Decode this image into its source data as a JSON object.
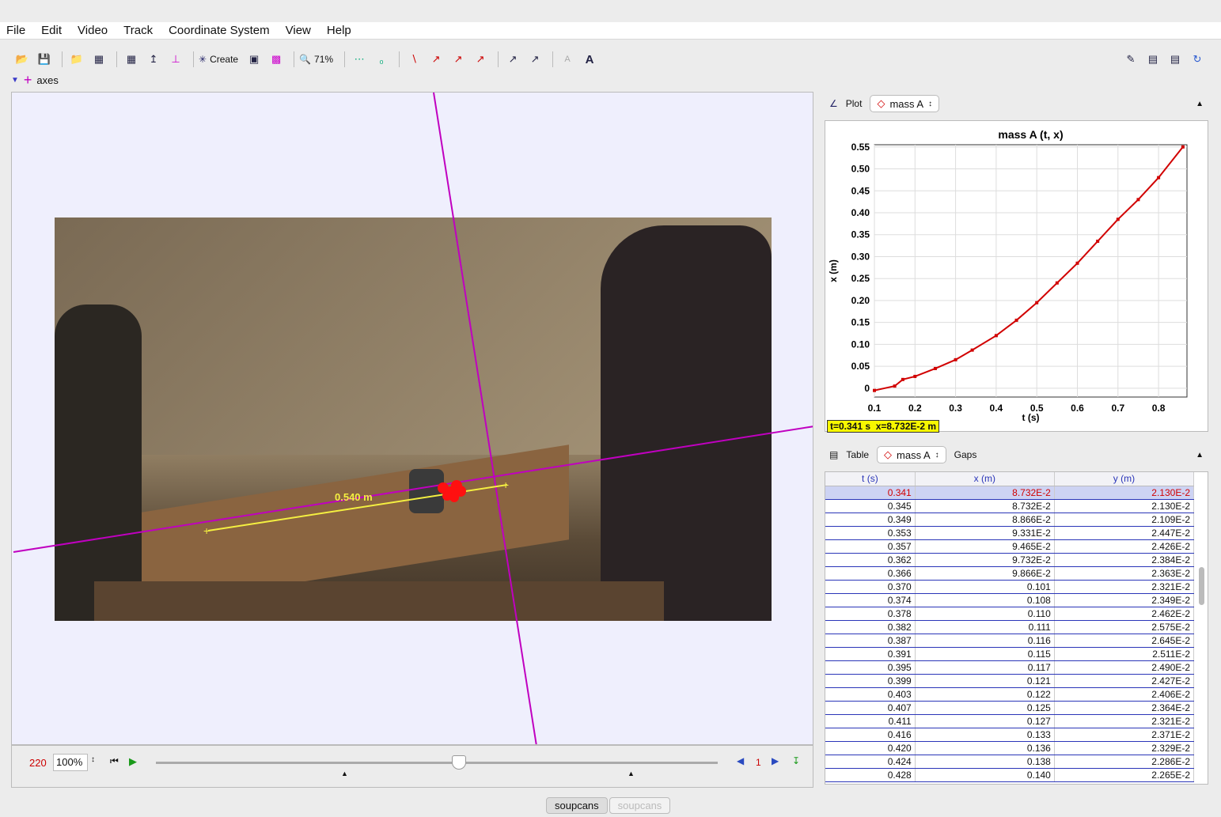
{
  "menu": [
    "File",
    "Edit",
    "Video",
    "Track",
    "Coordinate System",
    "View",
    "Help"
  ],
  "toolbar": {
    "create_label": "Create",
    "zoom_label": "71%"
  },
  "track_selector": {
    "label": "axes"
  },
  "video": {
    "measure_label": "0.540 m"
  },
  "player": {
    "frame": "220",
    "rate": "100%",
    "step": "1"
  },
  "plot_panel": {
    "tab_label": "Plot",
    "track": "mass A",
    "title": "mass A (t, x)",
    "xlabel": "t (s)",
    "ylabel": "x (m)",
    "readout": "t=0.341 s  x=8.732E-2 m"
  },
  "table_panel": {
    "tab_label": "Table",
    "track": "mass A",
    "gaps_label": "Gaps",
    "headers": [
      "t (s)",
      "x (m)",
      "y (m)"
    ],
    "rows": [
      [
        "0.341",
        "8.732E-2",
        "2.130E-2"
      ],
      [
        "0.345",
        "8.732E-2",
        "2.130E-2"
      ],
      [
        "0.349",
        "8.866E-2",
        "2.109E-2"
      ],
      [
        "0.353",
        "9.331E-2",
        "2.447E-2"
      ],
      [
        "0.357",
        "9.465E-2",
        "2.426E-2"
      ],
      [
        "0.362",
        "9.732E-2",
        "2.384E-2"
      ],
      [
        "0.366",
        "9.866E-2",
        "2.363E-2"
      ],
      [
        "0.370",
        "0.101",
        "2.321E-2"
      ],
      [
        "0.374",
        "0.108",
        "2.349E-2"
      ],
      [
        "0.378",
        "0.110",
        "2.462E-2"
      ],
      [
        "0.382",
        "0.111",
        "2.575E-2"
      ],
      [
        "0.387",
        "0.116",
        "2.645E-2"
      ],
      [
        "0.391",
        "0.115",
        "2.511E-2"
      ],
      [
        "0.395",
        "0.117",
        "2.490E-2"
      ],
      [
        "0.399",
        "0.121",
        "2.427E-2"
      ],
      [
        "0.403",
        "0.122",
        "2.406E-2"
      ],
      [
        "0.407",
        "0.125",
        "2.364E-2"
      ],
      [
        "0.411",
        "0.127",
        "2.321E-2"
      ],
      [
        "0.416",
        "0.133",
        "2.371E-2"
      ],
      [
        "0.420",
        "0.136",
        "2.329E-2"
      ],
      [
        "0.424",
        "0.138",
        "2.286E-2"
      ],
      [
        "0.428",
        "0.140",
        "2.265E-2"
      ]
    ]
  },
  "chart_data": {
    "type": "scatter",
    "title": "mass A (t, x)",
    "xlabel": "t (s)",
    "ylabel": "x (m)",
    "xlim": [
      0.1,
      0.87
    ],
    "ylim": [
      -0.02,
      0.555
    ],
    "xticks": [
      "0.1",
      "0.2",
      "0.3",
      "0.4",
      "0.5",
      "0.6",
      "0.7",
      "0.8"
    ],
    "yticks": [
      "0",
      "0.05",
      "0.10",
      "0.15",
      "0.20",
      "0.25",
      "0.30",
      "0.35",
      "0.40",
      "0.45",
      "0.50",
      "0.55"
    ],
    "grid": true,
    "color": "#d10000",
    "x": [
      0.1,
      0.15,
      0.17,
      0.2,
      0.25,
      0.3,
      0.341,
      0.4,
      0.45,
      0.5,
      0.55,
      0.6,
      0.65,
      0.7,
      0.75,
      0.8,
      0.86
    ],
    "y": [
      -0.005,
      0.005,
      0.02,
      0.027,
      0.045,
      0.065,
      0.087,
      0.12,
      0.155,
      0.195,
      0.24,
      0.285,
      0.335,
      0.385,
      0.43,
      0.48,
      0.55
    ]
  },
  "bottom_tabs": [
    "soupcans",
    "soupcans"
  ]
}
